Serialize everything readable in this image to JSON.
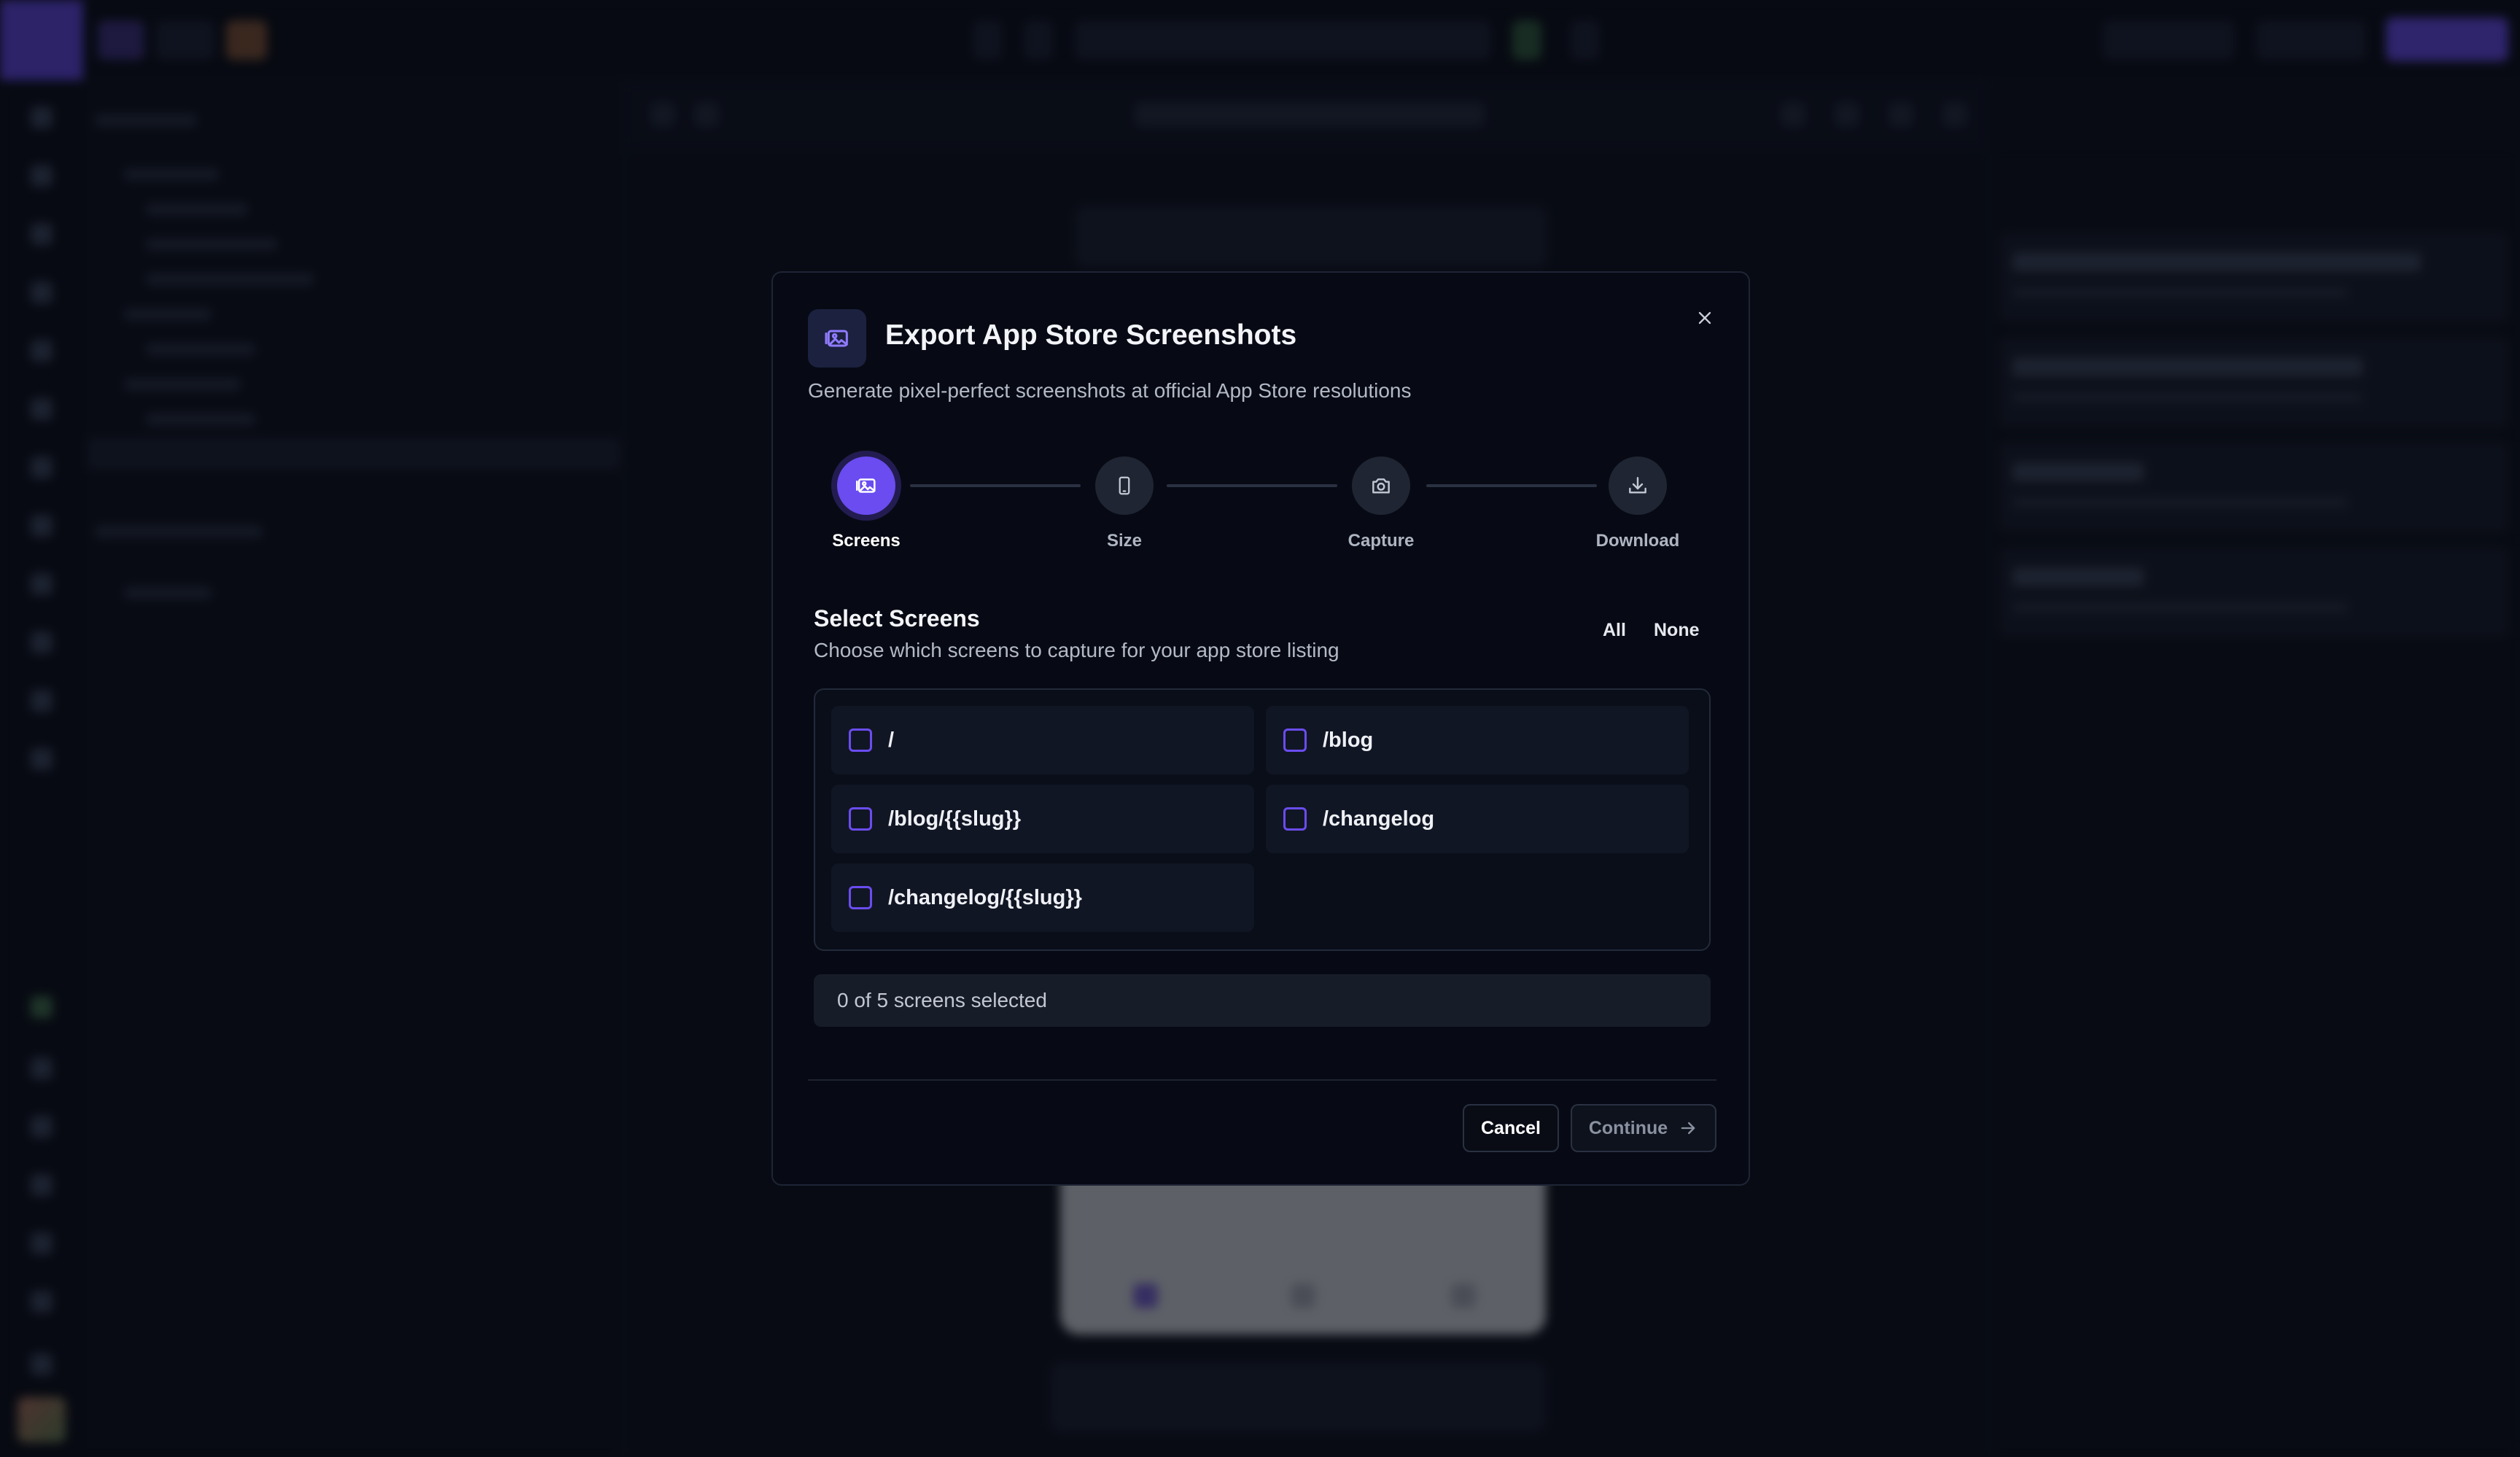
{
  "modal": {
    "title": "Export App Store Screenshots",
    "subtitle": "Generate pixel-perfect screenshots at official App Store resolutions",
    "header_icon": "image-icon",
    "close_icon": "close-icon"
  },
  "stepper": {
    "steps": [
      {
        "label": "Screens",
        "icon": "image-icon",
        "active": true
      },
      {
        "label": "Size",
        "icon": "phone-icon",
        "active": false
      },
      {
        "label": "Capture",
        "icon": "camera-icon",
        "active": false
      },
      {
        "label": "Download",
        "icon": "download-icon",
        "active": false
      }
    ]
  },
  "select_screens": {
    "title": "Select Screens",
    "description": "Choose which screens to capture for your app store listing",
    "all_label": "All",
    "none_label": "None",
    "screens": [
      {
        "label": "/",
        "checked": false
      },
      {
        "label": "/blog",
        "checked": false
      },
      {
        "label": "/blog/{{slug}}",
        "checked": false
      },
      {
        "label": "/changelog",
        "checked": false
      },
      {
        "label": "/changelog/{{slug}}",
        "checked": false
      }
    ],
    "selected_text": "0 of 5 screens selected"
  },
  "footer": {
    "cancel_label": "Cancel",
    "continue_label": "Continue",
    "continue_icon": "arrow-right-icon"
  },
  "colors": {
    "accent": "#6a4cf0",
    "modal_bg": "#070a14",
    "backdrop": "#0d111b"
  }
}
